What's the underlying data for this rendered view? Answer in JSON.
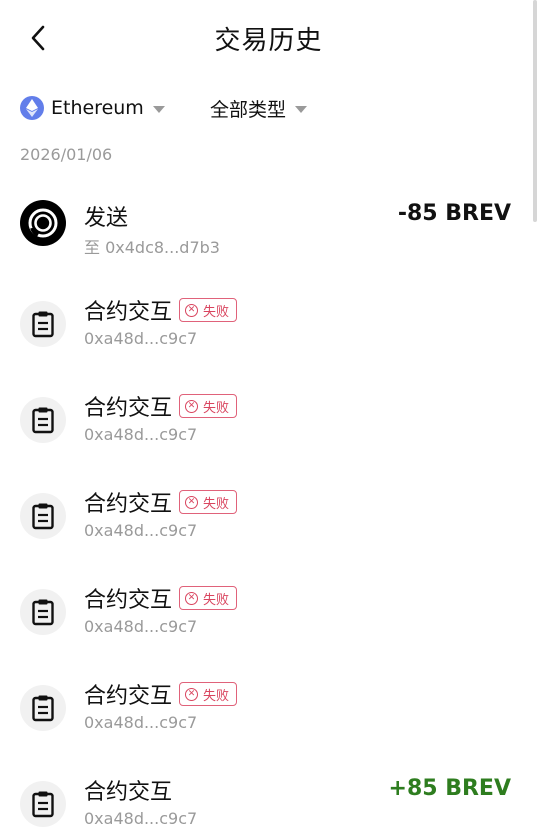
{
  "header": {
    "title": "交易历史",
    "back_icon": "chevron-left-icon"
  },
  "filters": {
    "chain": {
      "label": "Ethereum",
      "icon": "ethereum-icon"
    },
    "type": {
      "label": "全部类型"
    }
  },
  "date_group": "2026/01/06",
  "colors": {
    "eth": "#627eea",
    "failed": "#d9455f",
    "negative": "#111111",
    "positive": "#2e7d1f"
  },
  "transactions": [
    {
      "title": "发送",
      "subtitle": "至 0x4dc8...d7b3",
      "amount": "-85 BREV",
      "icon": "send-token-icon"
    },
    {
      "title": "合约交互",
      "status": "失败",
      "subtitle": "0xa48d...c9c7",
      "icon": "contract-clipboard-icon"
    },
    {
      "title": "合约交互",
      "status": "失败",
      "subtitle": "0xa48d...c9c7",
      "icon": "contract-clipboard-icon"
    },
    {
      "title": "合约交互",
      "status": "失败",
      "subtitle": "0xa48d...c9c7",
      "icon": "contract-clipboard-icon"
    },
    {
      "title": "合约交互",
      "status": "失败",
      "subtitle": "0xa48d...c9c7",
      "icon": "contract-clipboard-icon"
    },
    {
      "title": "合约交互",
      "status": "失败",
      "subtitle": "0xa48d...c9c7",
      "icon": "contract-clipboard-icon"
    },
    {
      "title": "合约交互",
      "subtitle": "0xa48d...c9c7",
      "amount": "+85 BREV",
      "icon": "contract-clipboard-icon"
    }
  ]
}
